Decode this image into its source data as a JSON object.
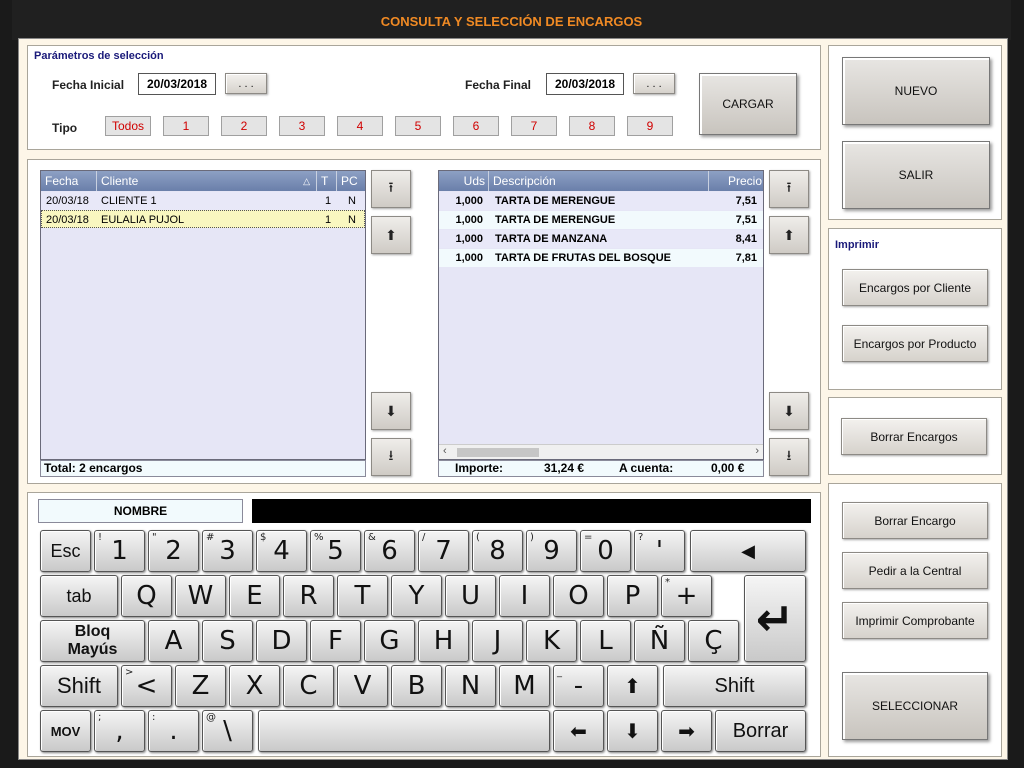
{
  "window": {
    "title": "CONSULTA Y SELECCIÓN DE ENCARGOS"
  },
  "params": {
    "heading": "Parámetros de selección",
    "fecha_inicial_label": "Fecha Inicial",
    "fecha_inicial_value": "20/03/2018",
    "fecha_final_label": "Fecha Final",
    "fecha_final_value": "20/03/2018",
    "picker_label": ". . .",
    "tipo_label": "Tipo",
    "tipo_options": [
      "Todos",
      "1",
      "2",
      "3",
      "4",
      "5",
      "6",
      "7",
      "8",
      "9"
    ],
    "cargar_label": "CARGAR"
  },
  "orders_grid": {
    "columns": [
      "Fecha",
      "Cliente",
      "T",
      "PC"
    ],
    "rows": [
      {
        "fecha": "20/03/18",
        "cliente": "CLIENTE 1",
        "t": "1",
        "pc": "N"
      },
      {
        "fecha": "20/03/18",
        "cliente": "EULALIA PUJOL",
        "t": "1",
        "pc": "N"
      }
    ],
    "total": "Total: 2 encargos"
  },
  "products_grid": {
    "columns": [
      "Uds",
      "Descripción",
      "Precio"
    ],
    "rows": [
      {
        "uds": "1,000",
        "desc": "TARTA DE MERENGUE",
        "precio": "7,51"
      },
      {
        "uds": "1,000",
        "desc": "TARTA DE MERENGUE",
        "precio": "7,51"
      },
      {
        "uds": "1,000",
        "desc": "TARTA DE MANZANA",
        "precio": "8,41"
      },
      {
        "uds": "1,000",
        "desc": "TARTA DE FRUTAS DEL BOSQUE",
        "precio": "7,81"
      }
    ],
    "importe_label": "Importe:",
    "importe_value": "31,24 €",
    "a_cuenta_label": "A cuenta:",
    "a_cuenta_value": "0,00 €"
  },
  "keyboard": {
    "field_label": "NOMBRE",
    "field_value": ""
  },
  "right": {
    "nuevo": "NUEVO",
    "salir": "SALIR",
    "imprimir_heading": "Imprimir",
    "encargos_cliente": "Encargos por Cliente",
    "encargos_producto": "Encargos por Producto",
    "borrar_encargos": "Borrar Encargos",
    "borrar_encargo": "Borrar Encargo",
    "pedir_central": "Pedir a la Central",
    "imprimir_comprobante": "Imprimir Comprobante",
    "seleccionar": "SELECCIONAR"
  },
  "keys": {
    "row1": [
      {
        "main": "Esc"
      },
      {
        "main": "1",
        "sub": "!"
      },
      {
        "main": "2",
        "sub": "\""
      },
      {
        "main": "3",
        "sub": "#"
      },
      {
        "main": "4",
        "sub": "$"
      },
      {
        "main": "5",
        "sub": "%"
      },
      {
        "main": "6",
        "sub": "&"
      },
      {
        "main": "7",
        "sub": "/"
      },
      {
        "main": "8",
        "sub": "("
      },
      {
        "main": "9",
        "sub": ")"
      },
      {
        "main": "0",
        "sub": "="
      },
      {
        "main": "'",
        "sub": "?"
      }
    ],
    "row2": [
      "tab",
      "Q",
      "W",
      "E",
      "R",
      "T",
      "Y",
      "U",
      "I",
      "O",
      "P"
    ],
    "plus": {
      "main": "+",
      "sub": "*"
    },
    "row3": [
      "A",
      "S",
      "D",
      "F",
      "G",
      "H",
      "J",
      "K",
      "L",
      "Ñ",
      "Ç"
    ],
    "bloq_line1": "Bloq",
    "bloq_line2": "Mayús",
    "row4": [
      "Z",
      "X",
      "C",
      "V",
      "B",
      "N",
      "M"
    ],
    "lt": {
      "main": "<",
      "sub": ">"
    },
    "minus": {
      "main": "-",
      "sub": "_"
    },
    "shift": "Shift",
    "mov": "MOV",
    "comma": {
      "main": ",",
      "sub": ";"
    },
    "dot": {
      "main": ".",
      "sub": ":"
    },
    "backslash": {
      "main": "\\",
      "sub": "@"
    },
    "borrar": "Borrar"
  }
}
